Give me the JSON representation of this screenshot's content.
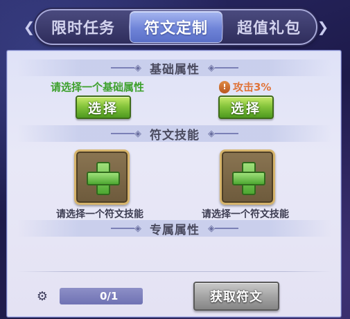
{
  "tabs": [
    {
      "label": "限时任务",
      "active": false
    },
    {
      "label": "符文定制",
      "active": true
    },
    {
      "label": "超值礼包",
      "active": false
    }
  ],
  "sections": {
    "base": {
      "title": "基础属性"
    },
    "skill": {
      "title": "符文技能"
    },
    "exclusive": {
      "title": "专属属性"
    }
  },
  "base_attr": {
    "left_prompt": "请选择一个基础属性",
    "right_value": "攻击3%",
    "left_button": "选择",
    "right_button": "选择"
  },
  "skills": {
    "left_label": "请选择一个符文技能",
    "right_label": "请选择一个符文技能"
  },
  "footer": {
    "counter": "0/1",
    "obtain_button": "获取符文"
  },
  "colors": {
    "accent_green": "#3ea12d",
    "attack_orange": "#e0743a",
    "tab_active": "#6f84d8"
  },
  "icons": {
    "counter": "rune-token-icon",
    "attack": "attack-shield-icon",
    "slot": "plus-icon"
  }
}
